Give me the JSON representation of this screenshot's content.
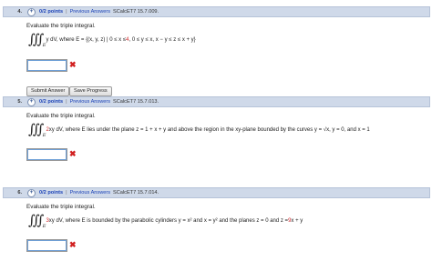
{
  "problems": [
    {
      "number": "4.",
      "plus": "+",
      "points": "0/2 points",
      "separator": "|",
      "previous_answers": "Previous Answers",
      "source": "SCalcET7 15.7.009.",
      "prompt": "Evaluate the triple integral.",
      "integrand": "y dV, where E = {(x, y, z) | 0 ≤ x ≤ ",
      "red1": "4",
      "rest1": ", 0 ≤ y ≤ x, x − y ≤ z ≤ x + y}",
      "region_sub": "E",
      "answer_value": "",
      "buttons": {
        "submit": "Submit Answer",
        "save": "Save Progress"
      }
    },
    {
      "number": "5.",
      "plus": "+",
      "points": "0/2 points",
      "separator": "|",
      "previous_answers": "Previous Answers",
      "source": "SCalcET7 15.7.013.",
      "prompt": "Evaluate the triple integral.",
      "red0": "2",
      "integrand": "xy dV, where E lies under the plane z = 1 + x + y and above the region in the xy-plane bounded by the curves y = √x, y = 0, and x = 1",
      "region_sub": "E",
      "answer_value": ""
    },
    {
      "number": "6.",
      "plus": "+",
      "points": "0/2 points",
      "separator": "|",
      "previous_answers": "Previous Answers",
      "source": "SCalcET7 15.7.014.",
      "prompt": "Evaluate the triple integral.",
      "red0": "3",
      "integrand": "xy dV, where E is bounded by the parabolic cylinders y = x² and x = y² and the planes z = 0 and z = ",
      "red1": "9",
      "rest1": "x + y",
      "region_sub": "E",
      "answer_value": ""
    }
  ],
  "colors": {
    "header_bg": "#cfd9e9",
    "link": "#1d44b8",
    "red": "#d0262a"
  },
  "icons": {
    "plus": "plus-circle-icon",
    "wrong": "x-mark-icon"
  }
}
